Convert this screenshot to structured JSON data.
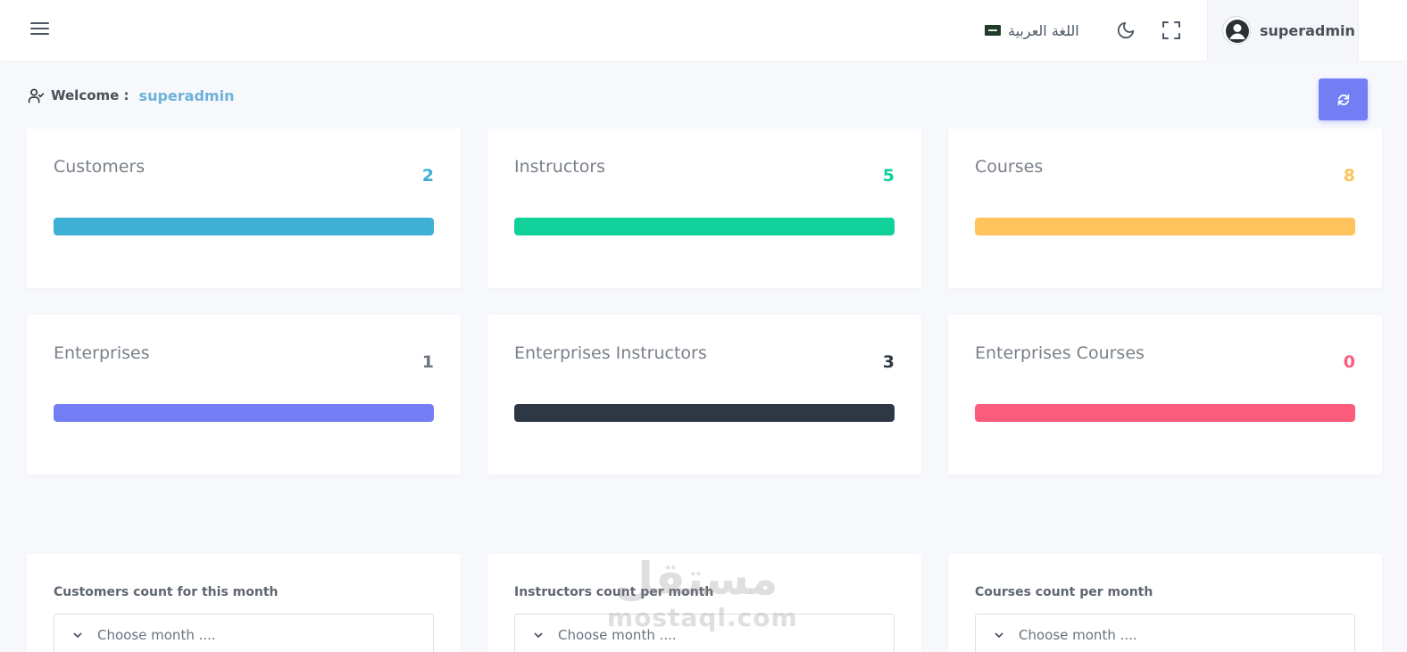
{
  "topbar": {
    "language_label": "اللغة العربية",
    "user_name": "superadmin",
    "icons": {
      "menu": "hamburger-icon",
      "flag": "saudi-flag-icon",
      "theme": "moon-icon",
      "fullscreen": "fullscreen-icon",
      "avatar": "user-avatar-icon"
    }
  },
  "welcome": {
    "label": "Welcome :",
    "user": "superadmin",
    "icon": "user-check-icon"
  },
  "refresh": {
    "icon": "refresh-icon",
    "color": "#737ef5"
  },
  "stats": [
    {
      "title": "Customers",
      "count": "2",
      "color": "#3eb0d5",
      "progress": 1.0
    },
    {
      "title": "Instructors",
      "count": "5",
      "color": "#0fd199",
      "progress": 1.0
    },
    {
      "title": "Courses",
      "count": "8",
      "color": "#fec35c",
      "progress": 1.0
    },
    {
      "title": "Enterprises",
      "count": "1",
      "color": "#737ef5",
      "count_color": "#6c757d",
      "progress": 1.0
    },
    {
      "title": "Enterprises Instructors",
      "count": "3",
      "color": "#2d3844",
      "progress": 1.0
    },
    {
      "title": "Enterprises Courses",
      "count": "0",
      "color": "#fc5c7c",
      "progress": 1.0
    }
  ],
  "month_cards": [
    {
      "title": "Customers count for this month",
      "placeholder": "Choose month ...."
    },
    {
      "title": "Instructors count per month",
      "placeholder": "Choose month ...."
    },
    {
      "title": "Courses count per month",
      "placeholder": "Choose month ...."
    }
  ],
  "watermark": {
    "arabic": "مستقل",
    "latin": "mostaql.com"
  }
}
